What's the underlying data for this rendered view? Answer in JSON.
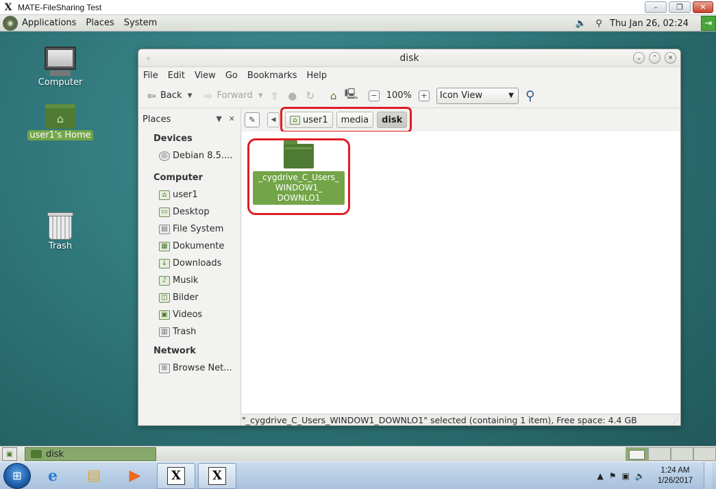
{
  "host": {
    "title": "MATE-FileSharing Test",
    "buttons": [
      "–",
      "❐",
      "✕"
    ]
  },
  "top_panel": {
    "menus": [
      "Applications",
      "Places",
      "System"
    ],
    "clock": "Thu Jan 26, 02:24"
  },
  "desktop": {
    "icons": [
      {
        "label": "Computer"
      },
      {
        "label": "user1's Home"
      },
      {
        "label": "Trash"
      }
    ]
  },
  "window": {
    "title": "disk",
    "menu": [
      "File",
      "Edit",
      "View",
      "Go",
      "Bookmarks",
      "Help"
    ],
    "toolbar": {
      "back": "Back",
      "forward": "Forward",
      "zoom": "100%",
      "view_mode": "Icon View"
    },
    "sidebar": {
      "header": "Places",
      "sections": [
        {
          "title": "Devices",
          "items": [
            "Debian 8.5...."
          ]
        },
        {
          "title": "Computer",
          "items": [
            "user1",
            "Desktop",
            "File System",
            "Dokumente",
            "Downloads",
            "Musik",
            "Bilder",
            "Videos",
            "Trash"
          ]
        },
        {
          "title": "Network",
          "items": [
            "Browse Net..."
          ]
        }
      ]
    },
    "path": [
      "user1",
      "media",
      "disk"
    ],
    "files": [
      {
        "name": "_cygdrive_C_Users_WINDOW1_DOWNLO1",
        "label_lines": [
          "_cygdrive_C_Users_",
          "WINDOW1_",
          "DOWNLO1"
        ]
      }
    ],
    "status": "\"_cygdrive_C_Users_WINDOW1_DOWNLO1\" selected (containing 1 item), Free space: 4.4 GB"
  },
  "bottom_panel": {
    "task": "disk",
    "workspace_count": 4,
    "active_workspace": 1
  },
  "taskbar": {
    "time": "1:24 AM",
    "date": "1/26/2017"
  },
  "colors": {
    "desktop_teal": "#2f7579",
    "folder_green": "#4f7a33",
    "selection_green": "#73a548",
    "highlight_red": "#e01b22"
  }
}
